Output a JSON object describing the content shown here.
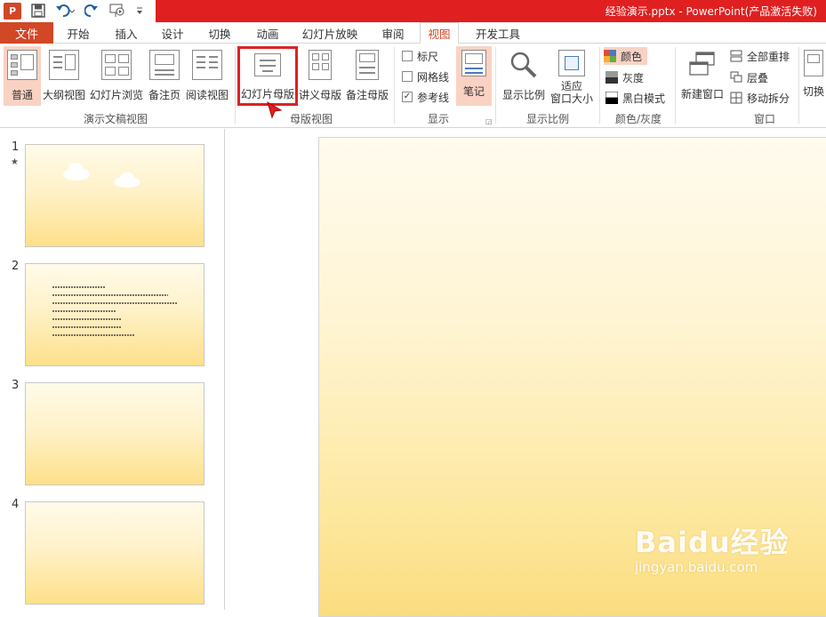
{
  "window": {
    "title": "经验演示.pptx -   PowerPoint(产品激活失败)",
    "app_icon_letter": "P"
  },
  "qat": {
    "icons": [
      "save-icon",
      "undo-icon",
      "redo-icon",
      "slideshow-from-start-icon",
      "customize-icon"
    ]
  },
  "tabs": {
    "file": "文件",
    "items": [
      "开始",
      "插入",
      "设计",
      "切换",
      "动画",
      "幻灯片放映",
      "审阅",
      "视图",
      "开发工具"
    ],
    "active": "视图"
  },
  "ribbon": {
    "presentation_views": {
      "label": "演示文稿视图",
      "buttons": [
        "普通",
        "大纲视图",
        "幻灯片浏览",
        "备注页",
        "阅读视图"
      ],
      "selected": "普通"
    },
    "master_views": {
      "label": "母版视图",
      "buttons": [
        "幻灯片母版",
        "讲义母版",
        "备注母版"
      ],
      "highlighted": "幻灯片母版"
    },
    "show": {
      "label": "显示",
      "checkboxes": [
        {
          "label": "标尺",
          "checked": false
        },
        {
          "label": "网格线",
          "checked": false
        },
        {
          "label": "参考线",
          "checked": true
        }
      ],
      "notes_button": "笔记"
    },
    "zoom": {
      "label": "显示比例",
      "zoom_button": "显示比例",
      "fit_button_line1": "适应",
      "fit_button_line2": "窗口大小"
    },
    "color_gray": {
      "label": "颜色/灰度",
      "options": [
        "颜色",
        "灰度",
        "黑白模式"
      ],
      "selected": "颜色"
    },
    "window": {
      "label": "窗口",
      "new_window": "新建窗口",
      "arrange_all": "全部重排",
      "cascade": "层叠",
      "move_split": "移动拆分",
      "switch": "切换"
    }
  },
  "slides": [
    {
      "number": "1",
      "has_animation_star": true,
      "star": "★"
    },
    {
      "number": "2",
      "has_animation_star": false
    },
    {
      "number": "3",
      "has_animation_star": false
    },
    {
      "number": "4",
      "has_animation_star": false
    }
  ],
  "watermark": {
    "brand": "Baidu经验",
    "url": "jingyan.baidu.com"
  },
  "colors": {
    "title_red": "#e02020",
    "file_tab": "#d24726",
    "selected_bg": "#f9d2c4",
    "highlight_box": "#dd2222",
    "slide_gradient_top": "#fffbee",
    "slide_gradient_bottom": "#fbdc80"
  }
}
